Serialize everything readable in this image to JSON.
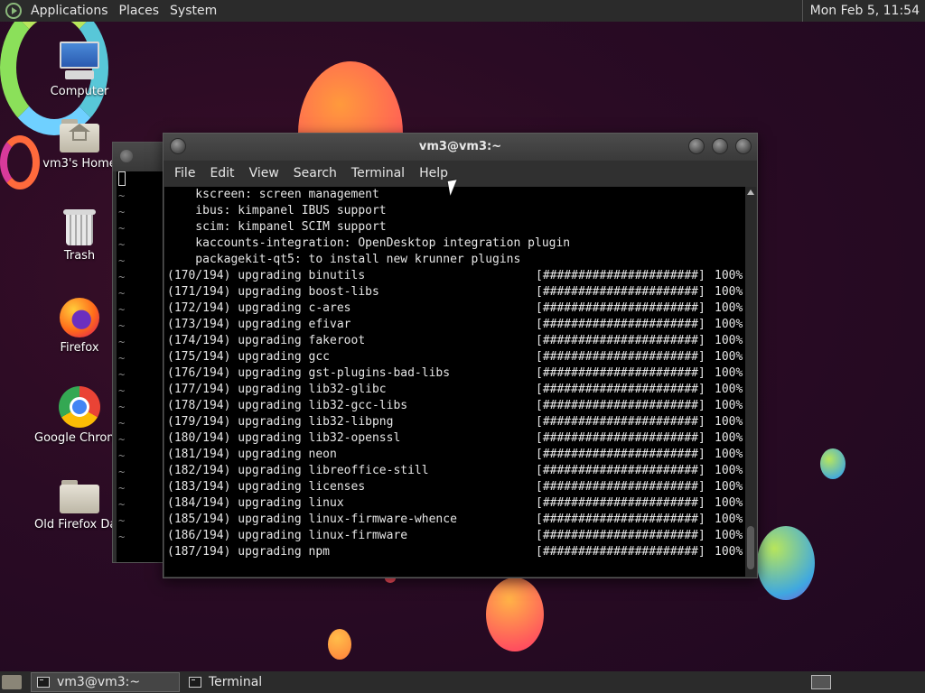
{
  "top_panel": {
    "menus": [
      "Applications",
      "Places",
      "System"
    ],
    "clock": "Mon Feb  5, 11:54"
  },
  "desktop": {
    "icons": [
      {
        "label": "Computer",
        "icon": "computer-icon"
      },
      {
        "label": "vm3's Home",
        "icon": "home-folder-icon"
      },
      {
        "label": "Trash",
        "icon": "trash-icon"
      },
      {
        "label": "Firefox",
        "icon": "firefox-icon"
      },
      {
        "label": "Google Chrome",
        "icon": "chrome-icon"
      },
      {
        "label": "Old Firefox Data",
        "icon": "folder-icon"
      }
    ]
  },
  "background_terminal": {
    "tilde": "~"
  },
  "terminal": {
    "title": "vm3@vm3:~",
    "menu": [
      "File",
      "Edit",
      "View",
      "Search",
      "Terminal",
      "Help"
    ],
    "plain_lines": [
      "    kscreen: screen management",
      "    ibus: kimpanel IBUS support",
      "    scim: kimpanel SCIM support",
      "    kaccounts-integration: OpenDesktop integration plugin",
      "    packagekit-qt5: to install new krunner plugins"
    ],
    "upgrades": [
      {
        "left": "(170/194) upgrading binutils",
        "bar": "[######################]",
        "pct": "100%"
      },
      {
        "left": "(171/194) upgrading boost-libs",
        "bar": "[######################]",
        "pct": "100%"
      },
      {
        "left": "(172/194) upgrading c-ares",
        "bar": "[######################]",
        "pct": "100%"
      },
      {
        "left": "(173/194) upgrading efivar",
        "bar": "[######################]",
        "pct": "100%"
      },
      {
        "left": "(174/194) upgrading fakeroot",
        "bar": "[######################]",
        "pct": "100%"
      },
      {
        "left": "(175/194) upgrading gcc",
        "bar": "[######################]",
        "pct": "100%"
      },
      {
        "left": "(176/194) upgrading gst-plugins-bad-libs",
        "bar": "[######################]",
        "pct": "100%"
      },
      {
        "left": "(177/194) upgrading lib32-glibc",
        "bar": "[######################]",
        "pct": "100%"
      },
      {
        "left": "(178/194) upgrading lib32-gcc-libs",
        "bar": "[######################]",
        "pct": "100%"
      },
      {
        "left": "(179/194) upgrading lib32-libpng",
        "bar": "[######################]",
        "pct": "100%"
      },
      {
        "left": "(180/194) upgrading lib32-openssl",
        "bar": "[######################]",
        "pct": "100%"
      },
      {
        "left": "(181/194) upgrading neon",
        "bar": "[######################]",
        "pct": "100%"
      },
      {
        "left": "(182/194) upgrading libreoffice-still",
        "bar": "[######################]",
        "pct": "100%"
      },
      {
        "left": "(183/194) upgrading licenses",
        "bar": "[######################]",
        "pct": "100%"
      },
      {
        "left": "(184/194) upgrading linux",
        "bar": "[######################]",
        "pct": "100%"
      },
      {
        "left": "(185/194) upgrading linux-firmware-whence",
        "bar": "[######################]",
        "pct": "100%"
      },
      {
        "left": "(186/194) upgrading linux-firmware",
        "bar": "[######################]",
        "pct": "100%"
      },
      {
        "left": "(187/194) upgrading npm",
        "bar": "[######################]",
        "pct": "100%"
      }
    ]
  },
  "taskbar": {
    "tasks": [
      {
        "label": "vm3@vm3:~",
        "active": true
      },
      {
        "label": "Terminal",
        "active": false
      }
    ]
  },
  "colors": {
    "panel": "#2b2b2b",
    "desktop_bg": "#2a0b24",
    "terminal_bg": "#000000",
    "terminal_text": "#e6e6e6"
  }
}
